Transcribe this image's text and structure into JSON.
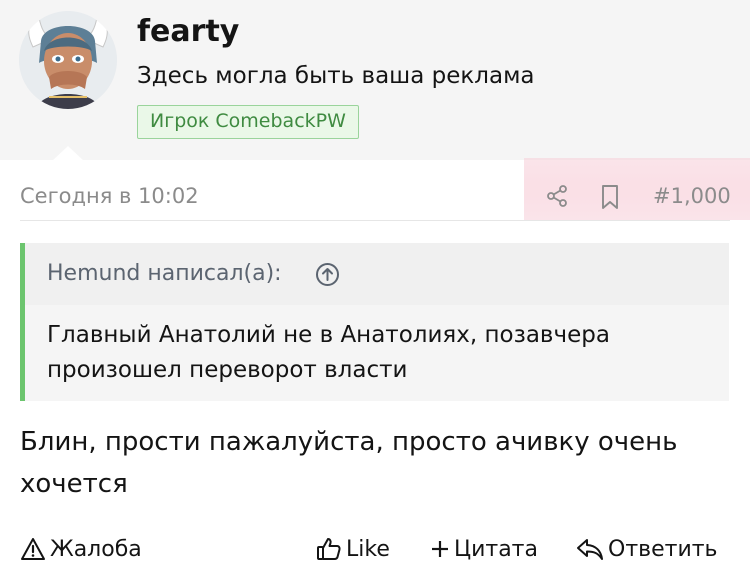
{
  "user": {
    "name": "fearty",
    "title": "Здесь могла быть ваша реклама",
    "banner": "Игрок ComebackPW",
    "avatar_icon": "user-avatar"
  },
  "meta": {
    "date": "Сегодня в 10:02",
    "share_icon": "share-icon",
    "bookmark_icon": "bookmark-icon",
    "post_number": "#1,000",
    "highlight_color": "#f9dde4"
  },
  "quote": {
    "author": "Hemund написал(а):",
    "jump_icon": "arrow-up-circle-icon",
    "text": "Главный Анатолий не в Анатолиях, позавчера произошел переворот власти",
    "accent_color": "#6cc56e"
  },
  "message": {
    "text": "Блин, прости пажалуйста, просто ачивку очень хочется"
  },
  "actions": {
    "report": "Жалоба",
    "like": "Like",
    "quote": "Цитата",
    "reply": "Ответить"
  }
}
